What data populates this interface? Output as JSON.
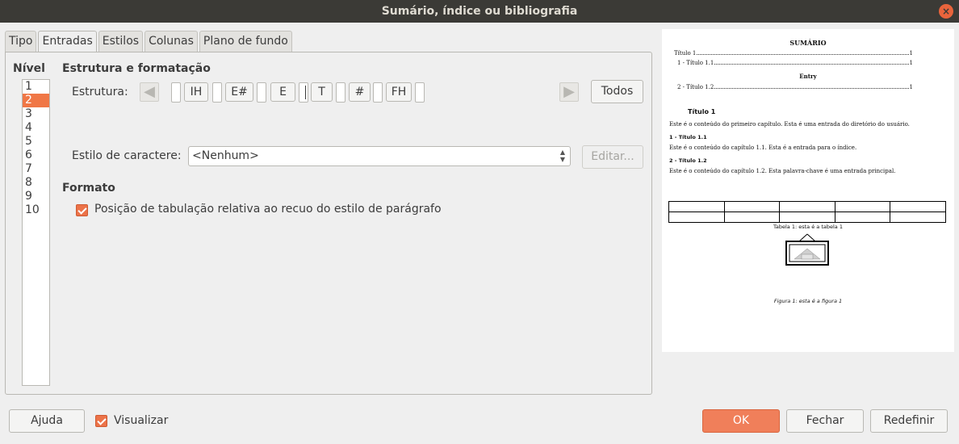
{
  "window": {
    "title": "Sumário, índice ou bibliografia",
    "close_glyph": "×"
  },
  "tabs": [
    "Tipo",
    "Entradas",
    "Estilos",
    "Colunas",
    "Plano de fundo"
  ],
  "active_tab": "Entradas",
  "level": {
    "header": "Nível",
    "items": [
      "1",
      "2",
      "3",
      "4",
      "5",
      "6",
      "7",
      "8",
      "9",
      "10"
    ],
    "selected": "2"
  },
  "structure": {
    "section_title": "Estrutura e formatação",
    "label": "Estrutura:",
    "tokens": [
      "IH",
      "E#",
      "E",
      "T",
      "#",
      "FH"
    ],
    "all_button": "Todos"
  },
  "char_style": {
    "label": "Estilo de caractere:",
    "value": "<Nenhum>",
    "edit_button": "Editar..."
  },
  "format": {
    "section_title": "Formato",
    "tab_relative_label": "Posição de tabulação relativa ao recuo do estilo de parágrafo",
    "tab_relative_checked": true
  },
  "footer": {
    "help": "Ajuda",
    "preview_label": "Visualizar",
    "preview_checked": true,
    "ok": "OK",
    "close": "Fechar",
    "reset": "Redefinir"
  },
  "preview": {
    "toc_title": "SUMÁRIO",
    "entries": [
      {
        "text": "Título 1",
        "page": "1"
      },
      {
        "text": "1 - Título 1.1",
        "page": "1"
      },
      {
        "text": "Entry",
        "page": ""
      },
      {
        "text": "2 - Título 1.2",
        "page": "1"
      }
    ],
    "heading1": "Título 1",
    "para1": "Este é o conteúdo do primeiro capítulo. Esta é uma entrada do diretório do usuário.",
    "heading11": "1 - Título 1.1",
    "para11": "Este é o conteúdo do capítulo 1.1. Esta é a entrada para o índice.",
    "heading12": "2 - Título 1.2",
    "para12": "Este é o conteúdo do capítulo 1.2. Esta palavra-chave é uma entrada principal.",
    "table_caption": "Tabela 1: esta é a tabela 1",
    "figure_caption": "Figura 1: esta é a figura 1"
  },
  "colors": {
    "accent": "#f07746",
    "titlebar": "#3b3a36",
    "close": "#e9643c"
  }
}
